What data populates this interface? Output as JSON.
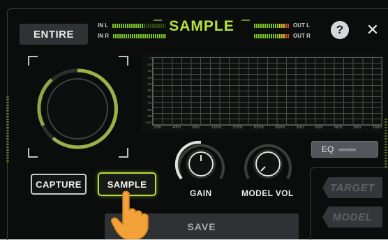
{
  "header": {
    "title": "SAMPLE",
    "entire_label": "ENTIRE",
    "help_label": "?",
    "close_label": "✕"
  },
  "meters": {
    "in_l": "IN L",
    "in_r": "IN R",
    "out_l": "OUT L",
    "out_r": "OUT R"
  },
  "eq_graph": {
    "db_labels": [
      "0",
      "-10",
      "-20",
      "-30",
      "-40",
      "-50",
      "-60",
      "-70",
      "-80",
      "-90",
      "-100"
    ],
    "freq_labels": [
      "20Hz",
      "40Hz",
      "60Hz",
      "100Hz",
      "300Hz",
      "500Hz",
      "900Hz",
      "2kHz",
      "6kHz",
      "8kHz",
      "9kHz",
      "20kHz"
    ]
  },
  "knobs": {
    "gain_label": "GAIN",
    "model_vol_label": "MODEL VOL"
  },
  "mode_buttons": {
    "capture_label": "CAPTURE",
    "sample_label": "SAMPLE"
  },
  "eq_button": {
    "label": "EQ",
    "arrows": "»»»»»»»»"
  },
  "side": {
    "target_label": "TARGET",
    "model_label": "MODEL"
  },
  "save_label": "SAVE",
  "colors": {
    "accent": "#b6e13b",
    "background": "#0b0d0c",
    "button_gray": "#2f3336"
  }
}
